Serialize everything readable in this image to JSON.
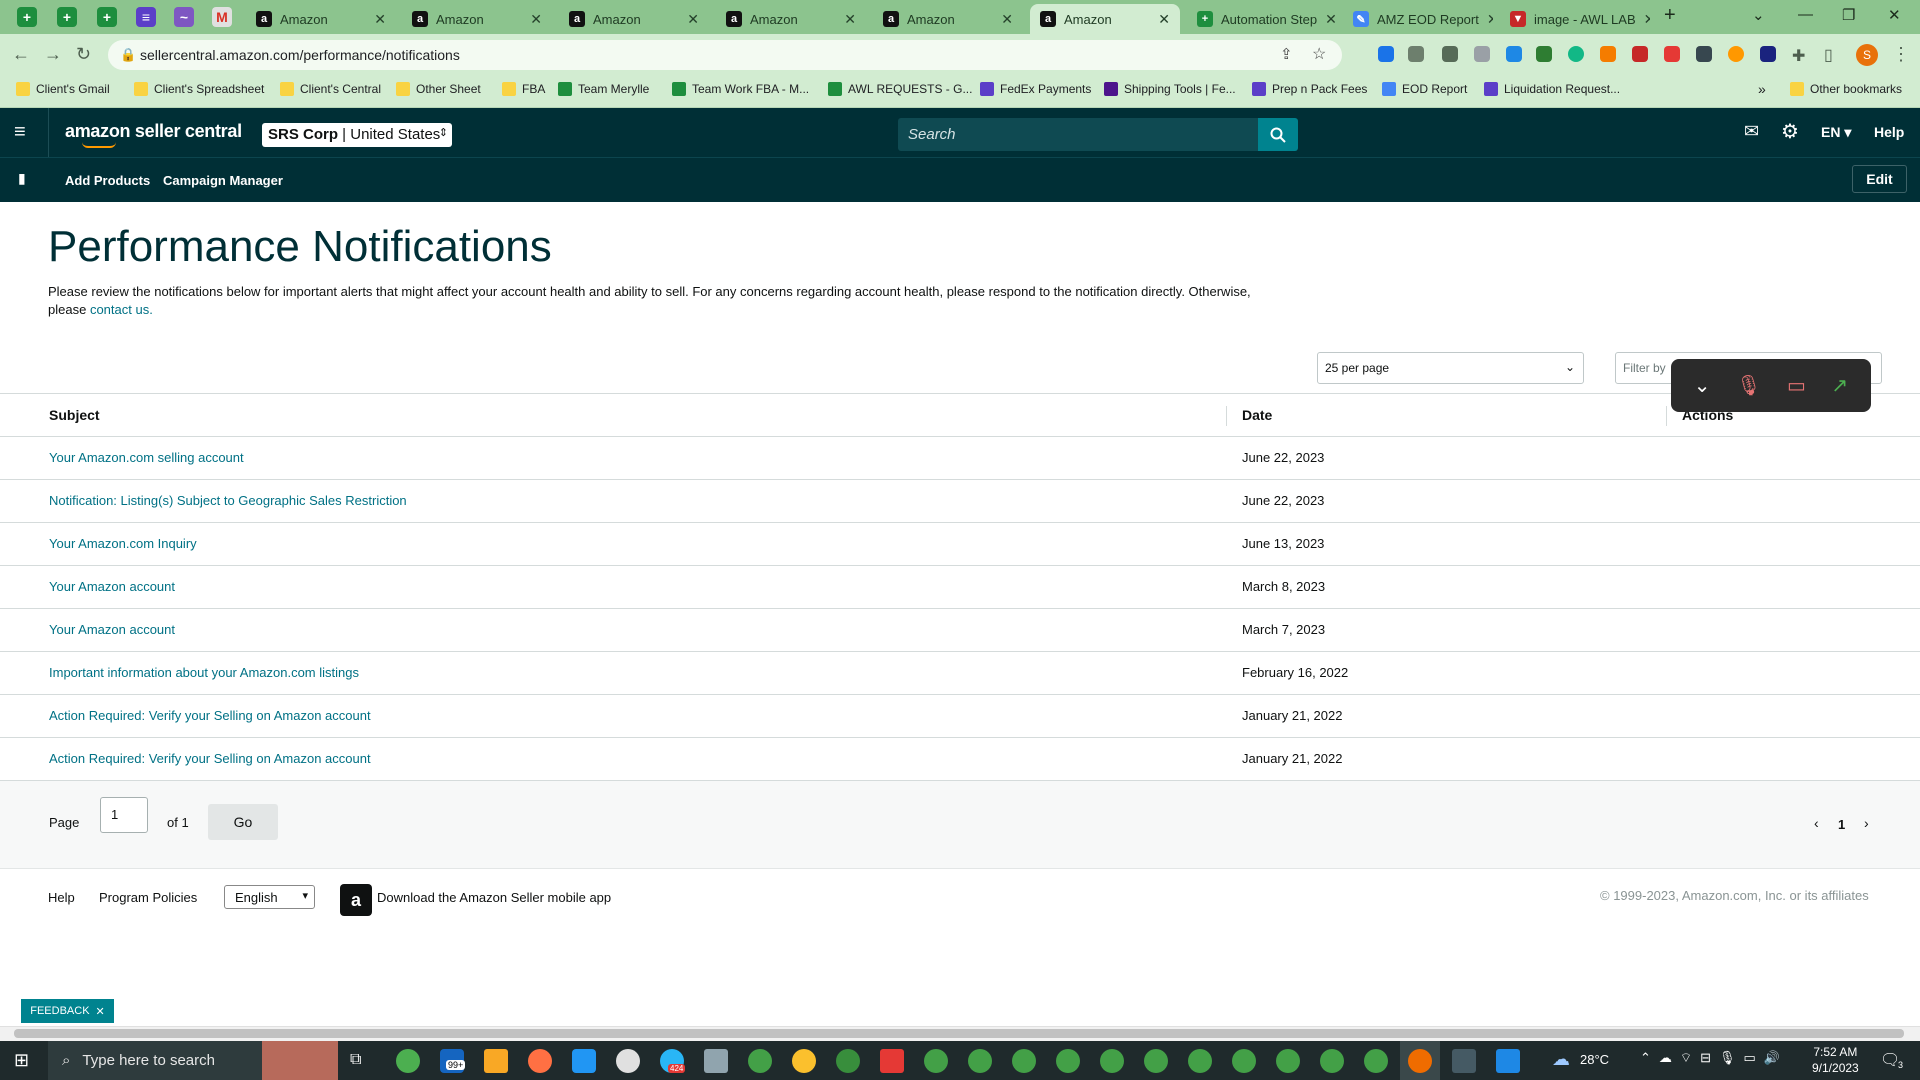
{
  "browser": {
    "tabs": [
      {
        "title": "Amazon",
        "active": false
      },
      {
        "title": "Amazon",
        "active": false
      },
      {
        "title": "Amazon",
        "active": false
      },
      {
        "title": "Amazon",
        "active": false
      },
      {
        "title": "Amazon",
        "active": false
      },
      {
        "title": "Amazon",
        "active": true
      },
      {
        "title": "Automation Step",
        "active": false
      },
      {
        "title": "AMZ EOD Report",
        "active": false
      },
      {
        "title": "image - AWL LAB",
        "active": false
      }
    ],
    "url": "sellercentral.amazon.com/performance/notifications",
    "bookmarks": [
      "Client's Gmail",
      "Client's Spreadsheet",
      "Client's Central",
      "Other Sheet",
      "FBA",
      "Team Merylle",
      "Team Work FBA - M...",
      "AWL REQUESTS - G...",
      "FedEx Payments",
      "Shipping Tools | Fe...",
      "Prep n Pack Fees",
      "EOD Report",
      "Liquidation Request...",
      "Other bookmarks"
    ],
    "profile_initial": "S",
    "more_bookmarks": "»"
  },
  "header": {
    "logo_text": "amazon seller central",
    "account_name": "SRS Corp",
    "account_region": "United States",
    "search_placeholder": "Search",
    "language": "EN",
    "help": "Help",
    "nav": [
      "Add Products",
      "Campaign Manager"
    ],
    "edit": "Edit"
  },
  "main": {
    "title": "Performance Notifications",
    "intro": "Please review the notifications below for important alerts that might affect your account health and ability to sell. For any concerns regarding account health, please respond to the notification directly. Otherwise, please",
    "intro_link": "contact us.",
    "per_page": "25 per page",
    "filter_placeholder": "Filter by",
    "columns": {
      "subject": "Subject",
      "date": "Date",
      "actions": "Actions"
    },
    "rows": [
      {
        "subject": "Your Amazon.com selling account",
        "date": "June 22, 2023"
      },
      {
        "subject": "Notification: Listing(s) Subject to Geographic Sales Restriction",
        "date": "June 22, 2023"
      },
      {
        "subject": "Your Amazon.com Inquiry",
        "date": "June 13, 2023"
      },
      {
        "subject": "Your Amazon account",
        "date": "March 8, 2023"
      },
      {
        "subject": "Your Amazon account",
        "date": "March 7, 2023"
      },
      {
        "subject": "Important information about your Amazon.com listings",
        "date": "February 16, 2022"
      },
      {
        "subject": "Action Required: Verify your Selling on Amazon account",
        "date": "January 21, 2022"
      },
      {
        "subject": "Action Required: Verify your Selling on Amazon account",
        "date": "January 21, 2022"
      }
    ],
    "pager": {
      "label": "Page",
      "value": "1",
      "of": "of 1",
      "go": "Go",
      "current": "1"
    }
  },
  "footer": {
    "help": "Help",
    "policies": "Program Policies",
    "language": "English",
    "app_text": "Download the Amazon Seller mobile app",
    "copyright": "© 1999-2023, Amazon.com, Inc. or its affiliates",
    "feedback": "FEEDBACK"
  },
  "taskbar": {
    "search_placeholder": "Type here to search",
    "weather": "28°C",
    "time": "7:52 AM",
    "date": "9/1/2023",
    "mail_badge": "99+",
    "telegram_badge": "424",
    "notification_count": "3"
  },
  "colors": {
    "header_bg": "#002f36",
    "link": "#007185",
    "accent": "#00838f",
    "tabstrip": "#8cc48e"
  }
}
